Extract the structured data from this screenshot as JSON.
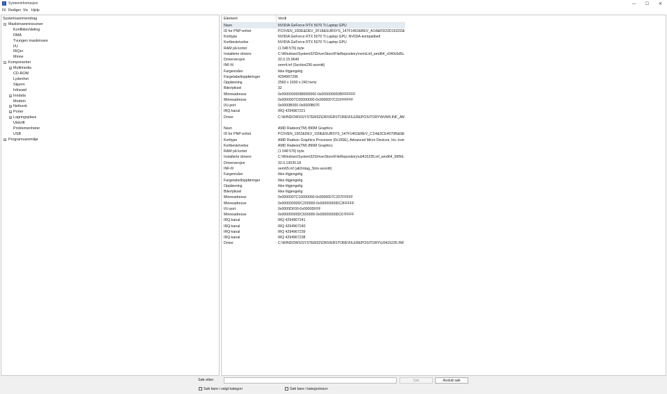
{
  "window": {
    "title": "Systeminformasjon",
    "controls": {
      "minimize": "—",
      "maximize": "☐",
      "close": "✕"
    }
  },
  "menu": [
    "Fil",
    "Rediger",
    "Vis",
    "Hjelp"
  ],
  "tree": [
    {
      "label": "Systemsammendrag",
      "level": 0,
      "expander": ""
    },
    {
      "label": "Maskinvareressurser",
      "level": 1,
      "expander": "−"
    },
    {
      "label": "Konflikter/deling",
      "level": 2,
      "expander": ""
    },
    {
      "label": "DMA",
      "level": 2,
      "expander": ""
    },
    {
      "label": "Tvungen maskinvare",
      "level": 2,
      "expander": ""
    },
    {
      "label": "I/U",
      "level": 2,
      "expander": ""
    },
    {
      "label": "IRQer",
      "level": 2,
      "expander": ""
    },
    {
      "label": "Minne",
      "level": 2,
      "expander": ""
    },
    {
      "label": "Komponenter",
      "level": 1,
      "expander": "−"
    },
    {
      "label": "Multimedia",
      "level": 2,
      "expander": "+"
    },
    {
      "label": "CD-ROM",
      "level": 2,
      "expander": ""
    },
    {
      "label": "Lydenhet",
      "level": 2,
      "expander": ""
    },
    {
      "label": "Skjerm",
      "level": 2,
      "expander": ""
    },
    {
      "label": "Infrarød",
      "level": 2,
      "expander": ""
    },
    {
      "label": "Inndata",
      "level": 2,
      "expander": "+"
    },
    {
      "label": "Modem",
      "level": 2,
      "expander": ""
    },
    {
      "label": "Nettverk",
      "level": 2,
      "expander": "+"
    },
    {
      "label": "Porter",
      "level": 2,
      "expander": "+"
    },
    {
      "label": "Lagringsplass",
      "level": 2,
      "expander": "+"
    },
    {
      "label": "Utskrift",
      "level": 2,
      "expander": ""
    },
    {
      "label": "Problemenheter",
      "level": 2,
      "expander": ""
    },
    {
      "label": "USB",
      "level": 2,
      "expander": ""
    },
    {
      "label": "Programvaremiljø",
      "level": 1,
      "expander": "+"
    }
  ],
  "columns": {
    "element": "Element",
    "value": "Verdi"
  },
  "rows": [
    {
      "k": "Navn",
      "v": "NVIDIA GeForce RTX 5070 Ti Laptop GPU",
      "sel": true
    },
    {
      "k": "ID for PNP-enhet",
      "v": "PCI\\VEN_10DE&DEV_2F18&SUBSYS_147F1462&REV_A1\\8&FD22D1632D&0&0000"
    },
    {
      "k": "Korttype",
      "v": "NVIDIA GeForce RTX 5070 Ti Laptop GPU, NVIDIA-kompatibelt"
    },
    {
      "k": "Kortbeskrivelse",
      "v": "NVIDIA GeForce RTX 5070 Ti Laptop GPU"
    },
    {
      "k": "RAM på kortet",
      "v": "(1 048 576) byte"
    },
    {
      "k": "Installerte drivere",
      "v": "C:\\Windows\\System32\\DriverStore\\FileRepository\\nvmii.inf_amd64_c040c6d5c..."
    },
    {
      "k": "Driverversjon",
      "v": "32.0.15.9649"
    },
    {
      "k": "INF-fil",
      "v": "oem4.inf (Section236-avsnitt)"
    },
    {
      "k": "Fargenivåer",
      "v": "Ikke tilgjengelig"
    },
    {
      "k": "Fargetabelloppføringer",
      "v": "4294967296"
    },
    {
      "k": "Oppløsning",
      "v": "2560 x 1600 x 240 hertz"
    },
    {
      "k": "Biter/piksel",
      "v": "32"
    },
    {
      "k": "Minneadresse",
      "v": "0x000000000B8000000-0x00000000DBFFFFFF"
    },
    {
      "k": "Minneadresse",
      "v": "0x0000007C00000000-0x0000007C01FFFFFF"
    },
    {
      "k": "I/U-port",
      "v": "0x0000B000-0x0000B07F"
    },
    {
      "k": "IRQ-kanal",
      "v": "IRQ 4294967221"
    },
    {
      "k": "Driver",
      "v": "C:\\WINDOWS\\SYSTEM32\\DRIVERSTORE\\FILEREPOSITORY\\NVMII.INF_AMD64_..."
    },
    {
      "k": "",
      "v": ""
    },
    {
      "k": "Navn",
      "v": "AMD Radeon(TM) 890M Graphics"
    },
    {
      "k": "ID for PNP-enhet",
      "v": "PCI\\VEN_1002&DEV_150E&SUBSYS_147F1462&REV_C1\\4&3CE4070B&0&0041"
    },
    {
      "k": "Korttype",
      "v": "AMD Radeon Graphics Processor (0x150E), Advanced Micro Devices, Inc.-kom..."
    },
    {
      "k": "Kortbeskrivelse",
      "v": "AMD Radeon(TM) 890M Graphics"
    },
    {
      "k": "RAM på kortet",
      "v": "(1 048 576) byte"
    },
    {
      "k": "Installerte drivere",
      "v": "C:\\Windows\\System32\\DriverStore\\FileRepository\\u0415235.inf_amd64_99f9d..."
    },
    {
      "k": "Driverversjon",
      "v": "32.0.13030.18"
    },
    {
      "k": "INF-fil",
      "v": "oem65.inf (ati2mtag_Strix-avsnitt)"
    },
    {
      "k": "Fargenivåer",
      "v": "Ikke tilgjengelig"
    },
    {
      "k": "Fargetabelloppføringer",
      "v": "Ikke tilgjengelig"
    },
    {
      "k": "Oppløsning",
      "v": "Ikke tilgjengelig"
    },
    {
      "k": "Biter/piksel",
      "v": "Ikke tilgjengelig"
    },
    {
      "k": "Minneadresse",
      "v": "0x0000007C10000000-0x0000007C207FFFFF"
    },
    {
      "k": "Minneadresse",
      "v": "0x00000000DC200000-0x00000000DC2FFFFF"
    },
    {
      "k": "I/U-port",
      "v": "0x0000DF00-0x0000DFFF"
    },
    {
      "k": "Minneadresse",
      "v": "0x00000000DC600000-0x00000000DC67FFFF"
    },
    {
      "k": "IRQ-kanal",
      "v": "IRQ 4294967241"
    },
    {
      "k": "IRQ-kanal",
      "v": "IRQ 4294967240"
    },
    {
      "k": "IRQ-kanal",
      "v": "IRQ 4294967239"
    },
    {
      "k": "IRQ-kanal",
      "v": "IRQ 4294967238"
    },
    {
      "k": "Driver",
      "v": "C:\\WINDOWS\\SYSTEM32\\DRIVERSTORE\\FILEREPOSITORY\\U0415235.INF_AMD..."
    }
  ],
  "search": {
    "label": "Søk etter:",
    "value": "",
    "find_button": "Søk",
    "close_button": "Avslutt søk",
    "option_selected_category": "Søk bare i valgt kategori",
    "option_category_names": "Søk bare i kategorinavn"
  }
}
